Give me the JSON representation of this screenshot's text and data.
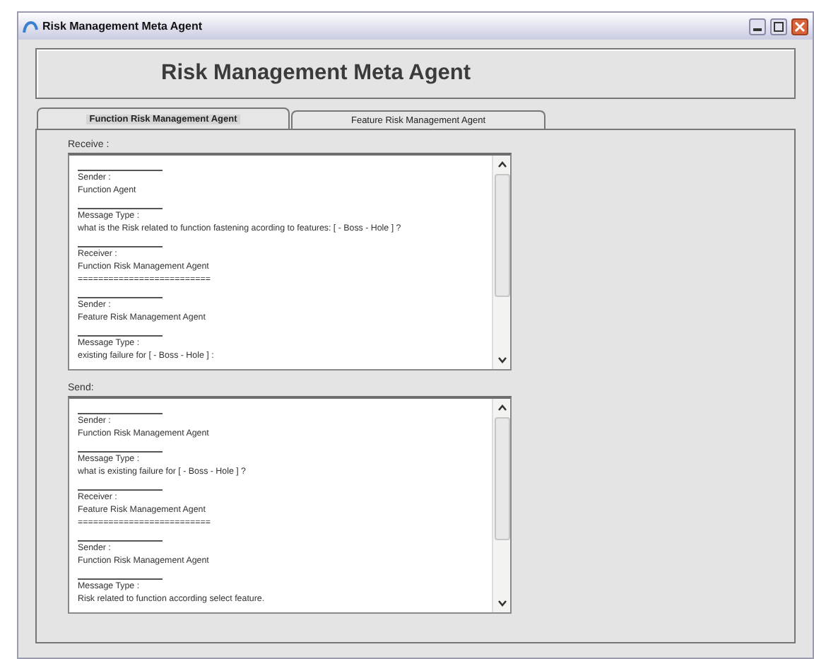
{
  "window": {
    "title": "Risk Management Meta Agent"
  },
  "header": {
    "title": "Risk Management Meta Agent"
  },
  "tabs": [
    {
      "label": "Function Risk Management Agent",
      "selected": true
    },
    {
      "label": "Feature Risk Management Agent",
      "selected": false
    }
  ],
  "panels": [
    {
      "label": "Receive :",
      "entries": [
        {
          "kind": "field",
          "label": "Sender :",
          "value": "Function Agent"
        },
        {
          "kind": "field",
          "label": "Message Type :",
          "value": "what is the Risk related to function fastening acording to features: [ - Boss - Hole   ] ?"
        },
        {
          "kind": "field",
          "label": "Receiver :",
          "value": "Function Risk Management Agent"
        },
        {
          "kind": "separator",
          "text": "=========================="
        },
        {
          "kind": "field",
          "label": "Sender :",
          "value": "Feature Risk Management Agent"
        },
        {
          "kind": "field",
          "label": "Message Type :",
          "value": "existing failure for  [ - Boss - Hole   ] :"
        }
      ]
    },
    {
      "label": "Send:",
      "entries": [
        {
          "kind": "field",
          "label": "Sender :",
          "value": "Function Risk Management Agent"
        },
        {
          "kind": "field",
          "label": "Message Type :",
          "value": "what is existing failure for  [ - Boss - Hole   ] ?"
        },
        {
          "kind": "field",
          "label": "Receiver :",
          "value": "Feature Risk Management Agent"
        },
        {
          "kind": "separator",
          "text": "=========================="
        },
        {
          "kind": "field",
          "label": "Sender :",
          "value": "Function Risk Management Agent"
        },
        {
          "kind": "field",
          "label": "Message Type :",
          "value": "Risk related to function according select feature."
        }
      ]
    }
  ]
}
